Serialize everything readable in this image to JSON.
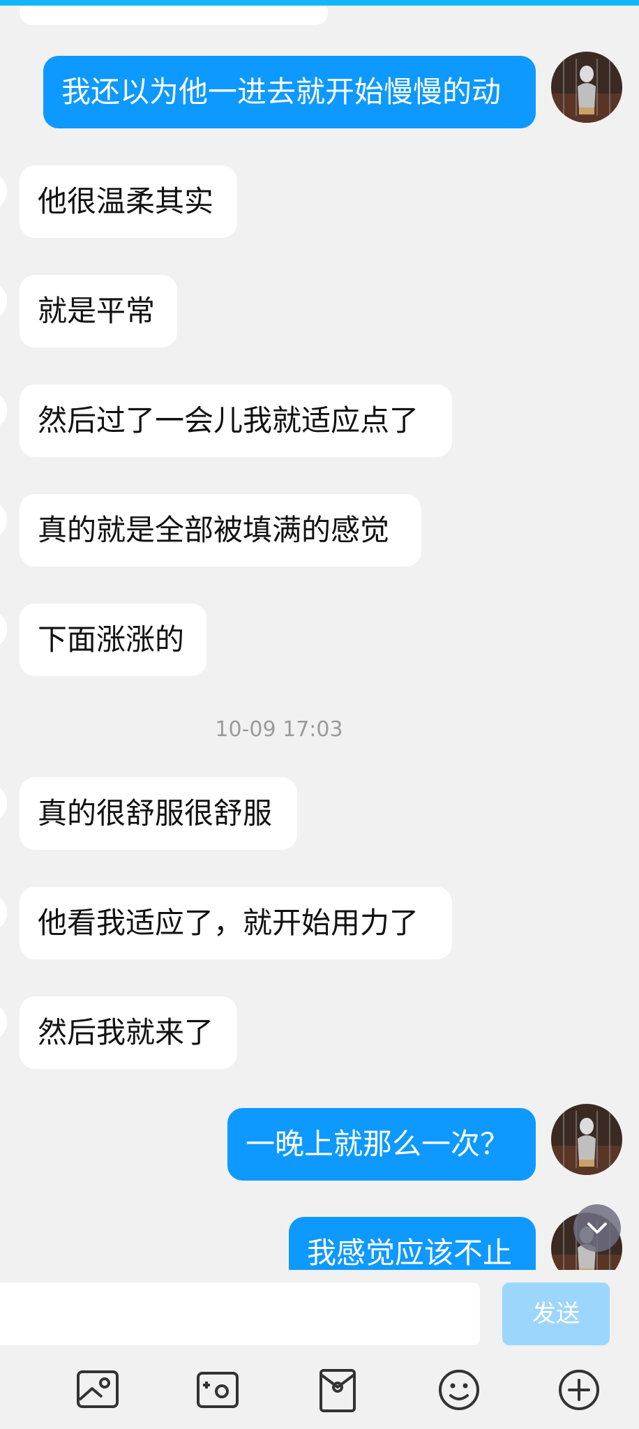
{
  "messages": [
    {
      "side": "out",
      "text": "我还以为他一进去就开始慢慢的动"
    },
    {
      "side": "in",
      "text": "他很温柔其实"
    },
    {
      "side": "in",
      "text": "就是平常"
    },
    {
      "side": "in",
      "text": "然后过了一会儿我就适应点了"
    },
    {
      "side": "in",
      "text": "真的就是全部被填满的感觉"
    },
    {
      "side": "in",
      "text": "下面涨涨的"
    },
    {
      "side": "in",
      "text": "真的很舒服很舒服"
    },
    {
      "side": "in",
      "text": "他看我适应了，就开始用力了"
    },
    {
      "side": "in",
      "text": "然后我就来了"
    },
    {
      "side": "out",
      "text": "一晚上就那么一次？"
    },
    {
      "side": "out",
      "text": "我感觉应该不止"
    }
  ],
  "timestamp": "10-09 17:03",
  "input": {
    "value": "",
    "send_label": "发送"
  },
  "toolbar": [
    "image-icon",
    "camera-icon",
    "red-packet-icon",
    "emoji-icon",
    "plus-icon"
  ],
  "colors": {
    "accent": "#12b7f5",
    "bubble_out": "#0d99ff",
    "bubble_in": "#ffffff",
    "background": "#f1f1f1",
    "send_disabled": "#9dd6fd"
  }
}
